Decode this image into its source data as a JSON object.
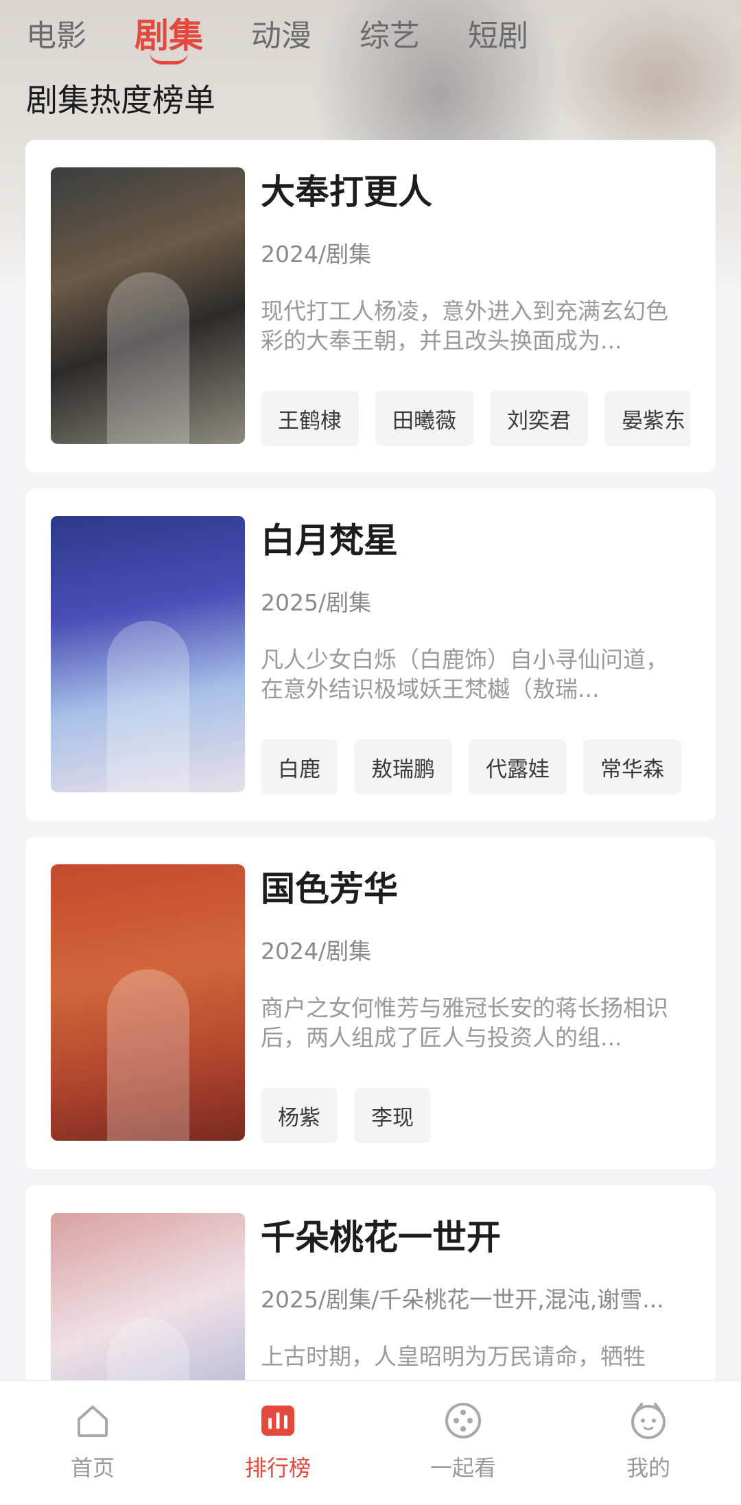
{
  "top_tabs": [
    {
      "label": "电影",
      "active": false
    },
    {
      "label": "剧集",
      "active": true
    },
    {
      "label": "动漫",
      "active": false
    },
    {
      "label": "综艺",
      "active": false
    },
    {
      "label": "短剧",
      "active": false
    }
  ],
  "section_title": "剧集热度榜单",
  "accent_color": "#e5483d",
  "items": [
    {
      "title": "大奉打更人",
      "meta": "2024/剧集",
      "description": "现代打工人杨凌，意外进入到充满玄幻色彩的大奉王朝，并且改头换面成为...",
      "cast": [
        "王鹤棣",
        "田曦薇",
        "刘奕君",
        "晏紫东"
      ]
    },
    {
      "title": "白月梵星",
      "meta": "2025/剧集",
      "description": "凡人少女白烁（白鹿饰）自小寻仙问道，在意外结识极域妖王梵樾（敖瑞...",
      "cast": [
        "白鹿",
        "敖瑞鹏",
        "代露娃",
        "常华森"
      ]
    },
    {
      "title": "国色芳华",
      "meta": "2024/剧集",
      "description": "商户之女何惟芳与雅冠长安的蒋长扬相识后，两人组成了匠人与投资人的组...",
      "cast": [
        "杨紫",
        "李现"
      ]
    },
    {
      "title": "千朵桃花一世开",
      "meta": "2025/剧集/千朵桃花一世开,混沌,谢雪...",
      "description": "上古时期，人皇昭明为万民请命，牺牲",
      "cast": []
    }
  ],
  "bottom_nav": [
    {
      "label": "首页",
      "icon": "home-icon",
      "active": false
    },
    {
      "label": "排行榜",
      "icon": "ranking-icon",
      "active": true
    },
    {
      "label": "一起看",
      "icon": "watch-together-icon",
      "active": false
    },
    {
      "label": "我的",
      "icon": "profile-icon",
      "active": false
    }
  ]
}
